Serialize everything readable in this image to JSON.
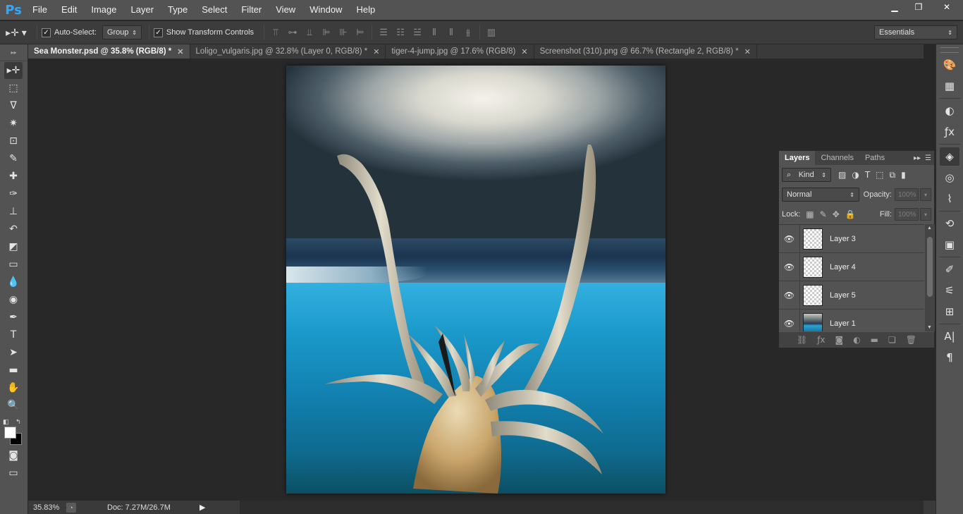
{
  "app": {
    "logo": "Ps"
  },
  "menu": [
    "File",
    "Edit",
    "Image",
    "Layer",
    "Type",
    "Select",
    "Filter",
    "View",
    "Window",
    "Help"
  ],
  "window_controls": {
    "minimize": "▁",
    "restore": "❐",
    "close": "✕"
  },
  "options": {
    "auto_select_label": "Auto-Select:",
    "auto_select_checked": true,
    "auto_select_target": "Group",
    "show_transform_label": "Show Transform Controls",
    "show_transform_checked": true,
    "workspace": "Essentials"
  },
  "tabs": [
    {
      "title": "Sea Monster.psd @ 35.8% (RGB/8) *",
      "active": true
    },
    {
      "title": "Loligo_vulgaris.jpg @ 32.8% (Layer 0, RGB/8) *",
      "active": false
    },
    {
      "title": "tiger-4-jump.jpg @ 17.6% (RGB/8)",
      "active": false
    },
    {
      "title": "Screenshot (310).png @ 66.7% (Rectangle 2, RGB/8) *",
      "active": false
    }
  ],
  "tools": [
    {
      "name": "move-tool",
      "glyph": "▸✛",
      "active": true
    },
    {
      "name": "marquee-tool",
      "glyph": "⬚"
    },
    {
      "name": "lasso-tool",
      "glyph": "ᐁ"
    },
    {
      "name": "magic-wand-tool",
      "glyph": "✷"
    },
    {
      "name": "crop-tool",
      "glyph": "⊡"
    },
    {
      "name": "eyedropper-tool",
      "glyph": "✎"
    },
    {
      "name": "healing-brush-tool",
      "glyph": "✚"
    },
    {
      "name": "brush-tool",
      "glyph": "✑"
    },
    {
      "name": "clone-stamp-tool",
      "glyph": "⊥"
    },
    {
      "name": "history-brush-tool",
      "glyph": "↶"
    },
    {
      "name": "eraser-tool",
      "glyph": "◩"
    },
    {
      "name": "gradient-tool",
      "glyph": "▭"
    },
    {
      "name": "blur-tool",
      "glyph": "💧"
    },
    {
      "name": "dodge-tool",
      "glyph": "◉"
    },
    {
      "name": "pen-tool",
      "glyph": "✒"
    },
    {
      "name": "type-tool",
      "glyph": "T"
    },
    {
      "name": "path-selection-tool",
      "glyph": "➤"
    },
    {
      "name": "rectangle-tool",
      "glyph": "▬"
    },
    {
      "name": "hand-tool",
      "glyph": "✋"
    },
    {
      "name": "zoom-tool",
      "glyph": "🔍"
    }
  ],
  "layers_panel": {
    "tabs": [
      "Layers",
      "Channels",
      "Paths"
    ],
    "active_tab": "Layers",
    "filter_kind": "Kind",
    "blend_mode": "Normal",
    "opacity_label": "Opacity:",
    "opacity_value": "100%",
    "lock_label": "Lock:",
    "fill_label": "Fill:",
    "fill_value": "100%",
    "layers": [
      {
        "name": "Layer 3",
        "visible": true,
        "thumb": "transparent"
      },
      {
        "name": "Layer 4",
        "visible": true,
        "thumb": "transparent"
      },
      {
        "name": "Layer 5",
        "visible": true,
        "thumb": "transparent"
      },
      {
        "name": "Layer 1",
        "visible": true,
        "thumb": "photo"
      }
    ]
  },
  "status": {
    "zoom": "35.83%",
    "doc": "Doc: 7.27M/26.7M"
  },
  "colors": {
    "foreground": "#ffffff",
    "background": "#000000",
    "accent": "#31a8ff"
  }
}
